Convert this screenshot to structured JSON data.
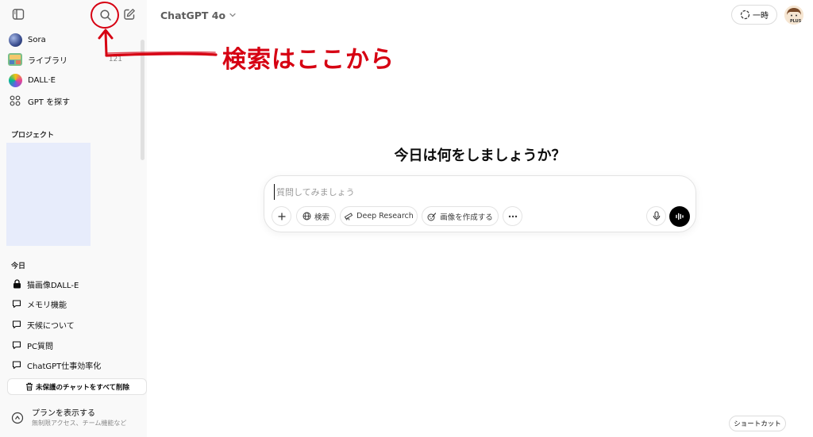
{
  "sidebar": {
    "items": [
      {
        "label": "Sora",
        "icon": "sora-logo-icon"
      },
      {
        "label": "ライブラリ",
        "icon": "library-thumbnail-icon",
        "count": "121"
      },
      {
        "label": "DALL·E",
        "icon": "dalle-logo-icon"
      },
      {
        "label": "GPT を探す",
        "icon": "grid-icon"
      }
    ],
    "projects_heading": "プロジェクト",
    "today_heading": "今日",
    "chats": [
      {
        "label": "猫画像DALL-E",
        "icon": "lock-icon"
      },
      {
        "label": "メモリ機能",
        "icon": "chat-bubble-icon"
      },
      {
        "label": "天候について",
        "icon": "chat-bubble-icon"
      },
      {
        "label": "PC質問",
        "icon": "chat-bubble-icon"
      },
      {
        "label": "ChatGPT仕事効率化",
        "icon": "chat-bubble-icon"
      }
    ],
    "delete_all": "未保護のチャットをすべて削除",
    "plan": {
      "title": "プランを表示する",
      "subtitle": "無制限アクセス、チーム機能など"
    }
  },
  "header": {
    "model": "ChatGPT 4o",
    "temporary": "一時",
    "avatar_badge": "PLUS"
  },
  "main": {
    "greeting": "今日は何をしましょうか？",
    "composer": {
      "placeholder": "質問してみましょう",
      "search": "検索",
      "deep_research": "Deep Research",
      "create_image": "画像を作成する"
    }
  },
  "shortcut": "ショートカット",
  "annotation": {
    "text": "検索はここから",
    "color": "#d60012"
  },
  "colors": {
    "sidebar_bg": "#f9f9f9",
    "project_box": "#e7ecfb",
    "accent_red": "#d60012"
  }
}
